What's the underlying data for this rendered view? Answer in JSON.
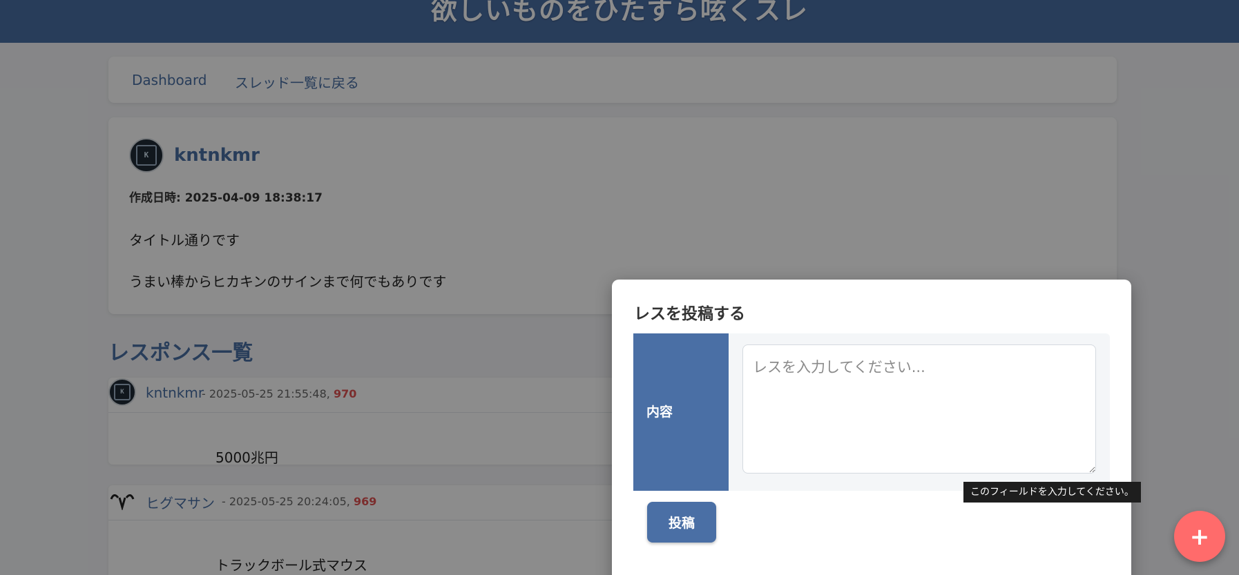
{
  "header": {
    "title": "欲しいものをひたすら呟くスレ"
  },
  "nav": {
    "dashboard_label": "Dashboard",
    "back_label": "スレッド一覧に戻る"
  },
  "thread": {
    "author": "kntnkmr",
    "created_label": "作成日時: 2025-04-09 18:38:17",
    "body_line1": "タイトル通りです",
    "body_line2": "うまい棒からヒカキンのサインまで何でもありです"
  },
  "responses": {
    "heading": "レスポンス一覧",
    "items": [
      {
        "name": "kntnkmr",
        "meta": "- 2025-05-25 21:55:48, ",
        "number": "970",
        "body": "5000兆円"
      },
      {
        "name": "ヒグマサン",
        "meta": "- 2025-05-25 20:24:05, ",
        "number": "969",
        "body": "トラックボール式マウス"
      }
    ]
  },
  "modal": {
    "title": "レスを投稿する",
    "field_label": "内容",
    "textarea_placeholder": "レスを入力してください...",
    "tooltip": "このフィールドを入力してください。",
    "submit_label": "投稿"
  },
  "fab": {
    "label": "+"
  },
  "colors": {
    "primary": "#4a6fa5",
    "accent": "#ff6b6b",
    "number": "#e05252"
  }
}
